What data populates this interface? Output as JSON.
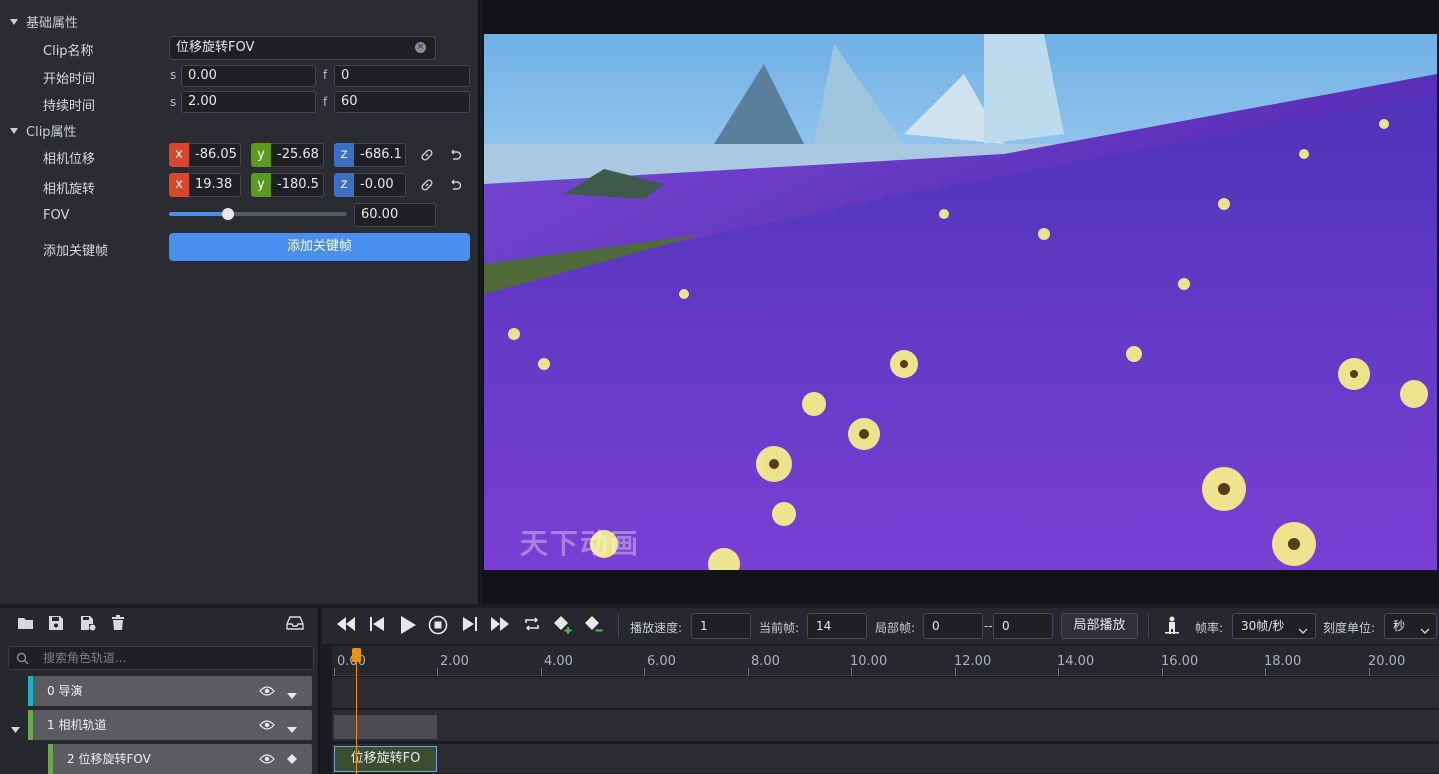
{
  "props": {
    "basic_section": "基础属性",
    "clip_section": "Clip属性",
    "clip_name_label": "Clip名称",
    "clip_name_value": "位移旋转FOV",
    "start_label": "开始时间",
    "start_s_unit": "s",
    "start_s": "0.00",
    "start_f_unit": "f",
    "start_f": "0",
    "dur_label": "持续时间",
    "dur_s_unit": "s",
    "dur_s": "2.00",
    "dur_f_unit": "f",
    "dur_f": "60",
    "cam_pos_label": "相机位移",
    "cam_pos": {
      "x": "-86.05",
      "y": "-25.68",
      "z": "-686.1"
    },
    "cam_rot_label": "相机旋转",
    "cam_rot": {
      "x": "19.38",
      "y": "-180.5",
      "z": "-0.00"
    },
    "axis_x": "x",
    "axis_y": "y",
    "axis_z": "z",
    "fov_label": "FOV",
    "fov_value": "60.00",
    "fov_fraction": 0.33,
    "add_kf_label": "添加关键帧",
    "add_kf_button": "添加关键帧"
  },
  "viewport": {
    "watermark": "天下动画"
  },
  "tracks": {
    "search_placeholder": "搜索角色轨道...",
    "items": [
      {
        "label": "0 导演",
        "color": "#1fb0c2"
      },
      {
        "label": "1 相机轨道",
        "color": "#6aa84f"
      },
      {
        "label": "2 位移旋转FOV",
        "color": "#6aa84f"
      }
    ]
  },
  "toolbar": {
    "speed_label": "播放速度:",
    "speed_value": "1",
    "current_frame_label": "当前帧:",
    "current_frame_value": "14",
    "local_frame_label": "局部帧:",
    "local_from": "0",
    "local_sep": "--",
    "local_to": "0",
    "local_play": "局部播放",
    "fps_label": "帧率:",
    "fps_value": "30帧/秒",
    "unit_label": "刻度单位:",
    "unit_value": "秒"
  },
  "timeline": {
    "ticks": [
      "0.00",
      "2.00",
      "4.00",
      "6.00",
      "8.00",
      "10.00",
      "12.00",
      "14.00",
      "16.00",
      "18.00",
      "20.00"
    ],
    "clip_label": "位移旋转FO"
  },
  "colors": {
    "accent": "#4a8ff0",
    "axis_x": "#d9472b",
    "axis_y": "#5a9a1e",
    "axis_z": "#3d6fc4",
    "playhead": "#e8920f"
  }
}
